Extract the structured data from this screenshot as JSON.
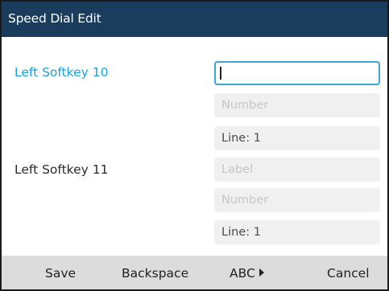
{
  "header": {
    "title": "Speed Dial Edit"
  },
  "entries": [
    {
      "label": "Left Softkey 10",
      "label_field": {
        "value": "",
        "placeholder": ""
      },
      "number_field": {
        "value": "",
        "placeholder": "Number"
      },
      "line_field": {
        "value": "Line: 1"
      }
    },
    {
      "label": "Left Softkey 11",
      "label_field": {
        "value": "",
        "placeholder": "Label"
      },
      "number_field": {
        "value": "",
        "placeholder": "Number"
      },
      "line_field": {
        "value": "Line: 1"
      }
    }
  ],
  "softkeys": {
    "save": "Save",
    "backspace": "Backspace",
    "abc": "ABC",
    "cancel": "Cancel"
  },
  "colors": {
    "header_bg": "#1a3d5e",
    "active_label": "#1aa3d9",
    "focus_border": "#3ba6dc",
    "softkey_bar": "#dcdcdc"
  }
}
